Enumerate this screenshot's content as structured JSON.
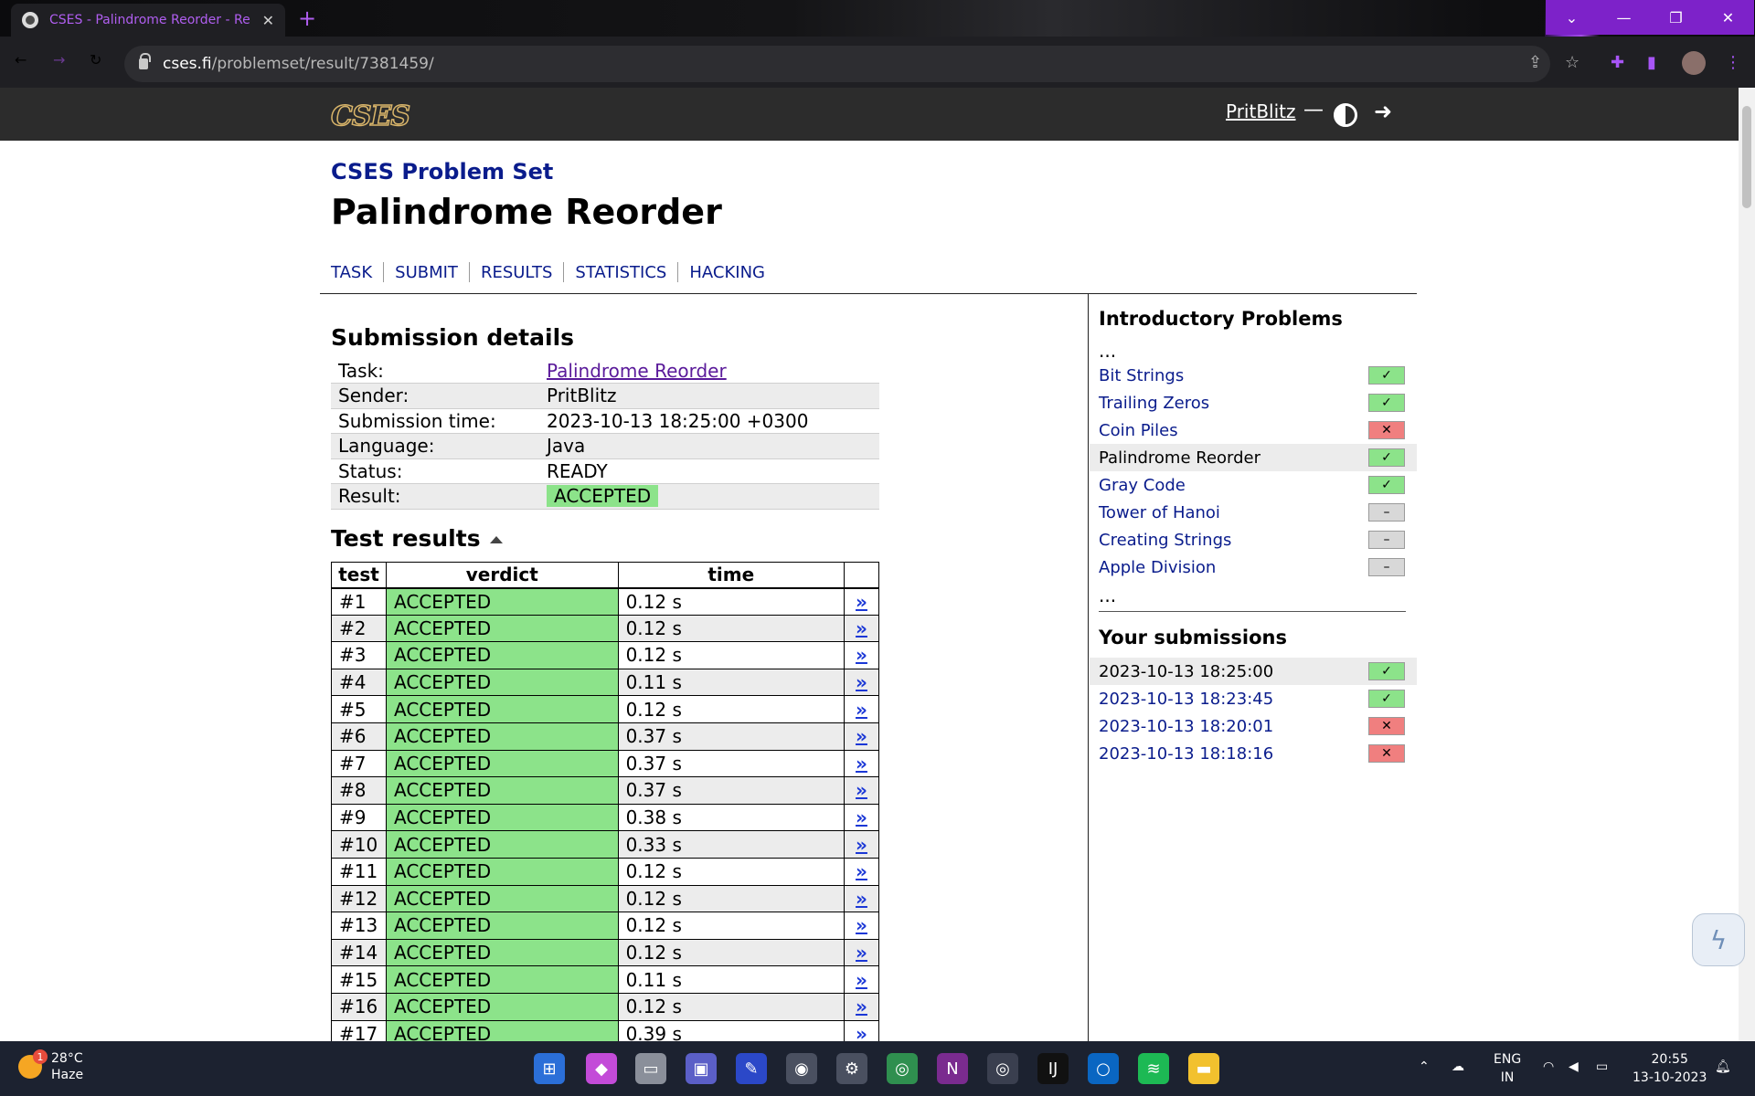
{
  "browser": {
    "tab_title": "CSES - Palindrome Reorder - Re",
    "tab_close": "✕",
    "new_tab": "+",
    "url_host": "cses.fi",
    "url_path": "/problemset/result/7381459/"
  },
  "header": {
    "logo": "CSES",
    "username": "PritBlitz",
    "dash": "—"
  },
  "page": {
    "crumb": "CSES Problem Set",
    "title": "Palindrome Reorder",
    "nav": [
      "TASK",
      "SUBMIT",
      "RESULTS",
      "STATISTICS",
      "HACKING"
    ]
  },
  "details": {
    "heading": "Submission details",
    "rows": [
      {
        "key": "Task:",
        "value": "Palindrome Reorder"
      },
      {
        "key": "Sender:",
        "value": "PritBlitz"
      },
      {
        "key": "Submission time:",
        "value": "2023-10-13 18:25:00 +0300"
      },
      {
        "key": "Language:",
        "value": "Java"
      },
      {
        "key": "Status:",
        "value": "READY"
      },
      {
        "key": "Result:",
        "value": "ACCEPTED"
      }
    ]
  },
  "tests": {
    "heading": "Test results",
    "columns": [
      "test",
      "verdict",
      "time"
    ],
    "link_glyph": "»",
    "rows": [
      {
        "test": "#1",
        "verdict": "ACCEPTED",
        "time": "0.12 s"
      },
      {
        "test": "#2",
        "verdict": "ACCEPTED",
        "time": "0.12 s"
      },
      {
        "test": "#3",
        "verdict": "ACCEPTED",
        "time": "0.12 s"
      },
      {
        "test": "#4",
        "verdict": "ACCEPTED",
        "time": "0.11 s"
      },
      {
        "test": "#5",
        "verdict": "ACCEPTED",
        "time": "0.12 s"
      },
      {
        "test": "#6",
        "verdict": "ACCEPTED",
        "time": "0.37 s"
      },
      {
        "test": "#7",
        "verdict": "ACCEPTED",
        "time": "0.37 s"
      },
      {
        "test": "#8",
        "verdict": "ACCEPTED",
        "time": "0.37 s"
      },
      {
        "test": "#9",
        "verdict": "ACCEPTED",
        "time": "0.38 s"
      },
      {
        "test": "#10",
        "verdict": "ACCEPTED",
        "time": "0.33 s"
      },
      {
        "test": "#11",
        "verdict": "ACCEPTED",
        "time": "0.12 s"
      },
      {
        "test": "#12",
        "verdict": "ACCEPTED",
        "time": "0.12 s"
      },
      {
        "test": "#13",
        "verdict": "ACCEPTED",
        "time": "0.12 s"
      },
      {
        "test": "#14",
        "verdict": "ACCEPTED",
        "time": "0.12 s"
      },
      {
        "test": "#15",
        "verdict": "ACCEPTED",
        "time": "0.11 s"
      },
      {
        "test": "#16",
        "verdict": "ACCEPTED",
        "time": "0.12 s"
      },
      {
        "test": "#17",
        "verdict": "ACCEPTED",
        "time": "0.39 s"
      }
    ]
  },
  "sidebar": {
    "heading": "Introductory Problems",
    "ellipsis": "...",
    "problems": [
      {
        "name": "Bit Strings",
        "status": "ok"
      },
      {
        "name": "Trailing Zeros",
        "status": "ok"
      },
      {
        "name": "Coin Piles",
        "status": "bad"
      },
      {
        "name": "Palindrome Reorder",
        "status": "ok",
        "current": true
      },
      {
        "name": "Gray Code",
        "status": "ok"
      },
      {
        "name": "Tower of Hanoi",
        "status": "none"
      },
      {
        "name": "Creating Strings",
        "status": "none"
      },
      {
        "name": "Apple Division",
        "status": "none"
      }
    ],
    "submissions_heading": "Your submissions",
    "submissions": [
      {
        "time": "2023-10-13 18:25:00",
        "status": "ok",
        "current": true
      },
      {
        "time": "2023-10-13 18:23:45",
        "status": "ok"
      },
      {
        "time": "2023-10-13 18:20:01",
        "status": "bad"
      },
      {
        "time": "2023-10-13 18:18:16",
        "status": "bad"
      }
    ],
    "glyphs": {
      "ok": "✓",
      "bad": "✕",
      "none": "–"
    }
  },
  "taskbar": {
    "weather_temp": "28°C",
    "weather_desc": "Haze",
    "weather_badge": "1",
    "lang_top": "ENG",
    "lang_bottom": "IN",
    "time": "20:55",
    "date": "13-10-2023"
  },
  "colors": {
    "accent_purple": "#a855f7",
    "link_blue": "#0a1c8c",
    "accepted_green": "#8ce38a",
    "wrong_red": "#f07f7f"
  }
}
